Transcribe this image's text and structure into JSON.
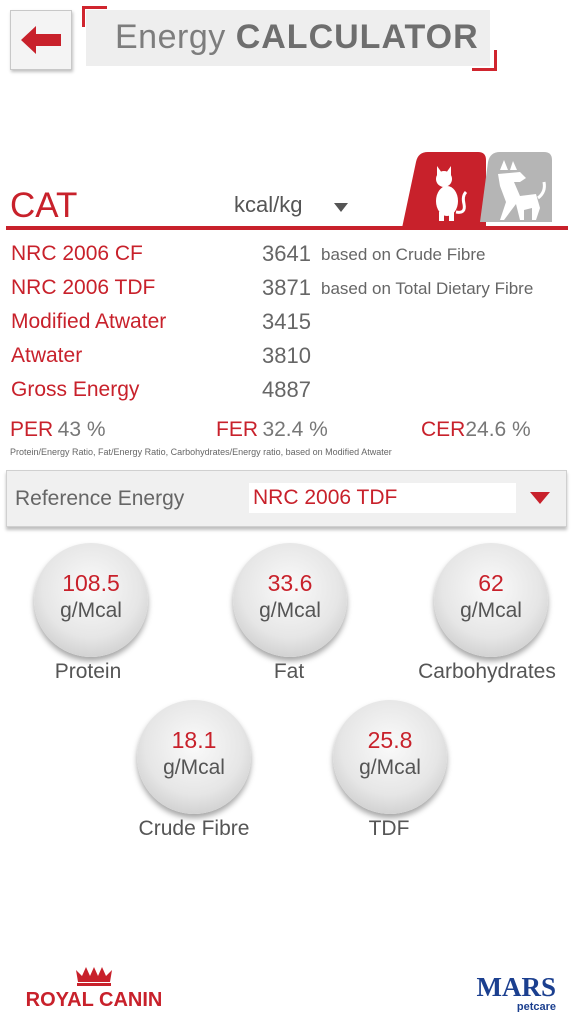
{
  "header": {
    "title_light": "Energy",
    "title_bold": "CALCULATOR",
    "back_icon": "arrow-left-icon",
    "accent_color": "#c8212b"
  },
  "species": {
    "label": "CAT",
    "unit": "kcal/kg",
    "tabs": [
      "cat-icon",
      "dog-icon"
    ],
    "selected": "cat"
  },
  "energy_rows": [
    {
      "label": "NRC 2006 CF",
      "value": "3641",
      "note": "based on Crude Fibre"
    },
    {
      "label": "NRC 2006 TDF",
      "value": "3871",
      "note": "based on Total Dietary Fibre"
    },
    {
      "label": "Modified Atwater",
      "value": "3415",
      "note": ""
    },
    {
      "label": "Atwater",
      "value": "3810",
      "note": ""
    },
    {
      "label": "Gross Energy",
      "value": "4887",
      "note": ""
    }
  ],
  "ratios": {
    "per_label": "PER",
    "per_value": "43 %",
    "fer_label": "FER",
    "fer_value": "32.4 %",
    "cer_label": "CER",
    "cer_value": "24.6 %",
    "footnote": "Protein/Energy Ratio, Fat/Energy Ratio, Carbohydrates/Energy ratio, based on Modified Atwater"
  },
  "reference": {
    "label": "Reference Energy",
    "selected": "NRC 2006 TDF"
  },
  "nutrients": [
    {
      "value": "108.5",
      "unit": "g/Mcal",
      "name": "Protein"
    },
    {
      "value": "33.6",
      "unit": "g/Mcal",
      "name": "Fat"
    },
    {
      "value": "62",
      "unit": "g/Mcal",
      "name": "Carbohydrates"
    },
    {
      "value": "18.1",
      "unit": "g/Mcal",
      "name": "Crude Fibre"
    },
    {
      "value": "25.8",
      "unit": "g/Mcal",
      "name": "TDF"
    }
  ],
  "logos": {
    "left": "ROYAL CANIN",
    "right_main": "MARS",
    "right_sub": "petcare"
  }
}
